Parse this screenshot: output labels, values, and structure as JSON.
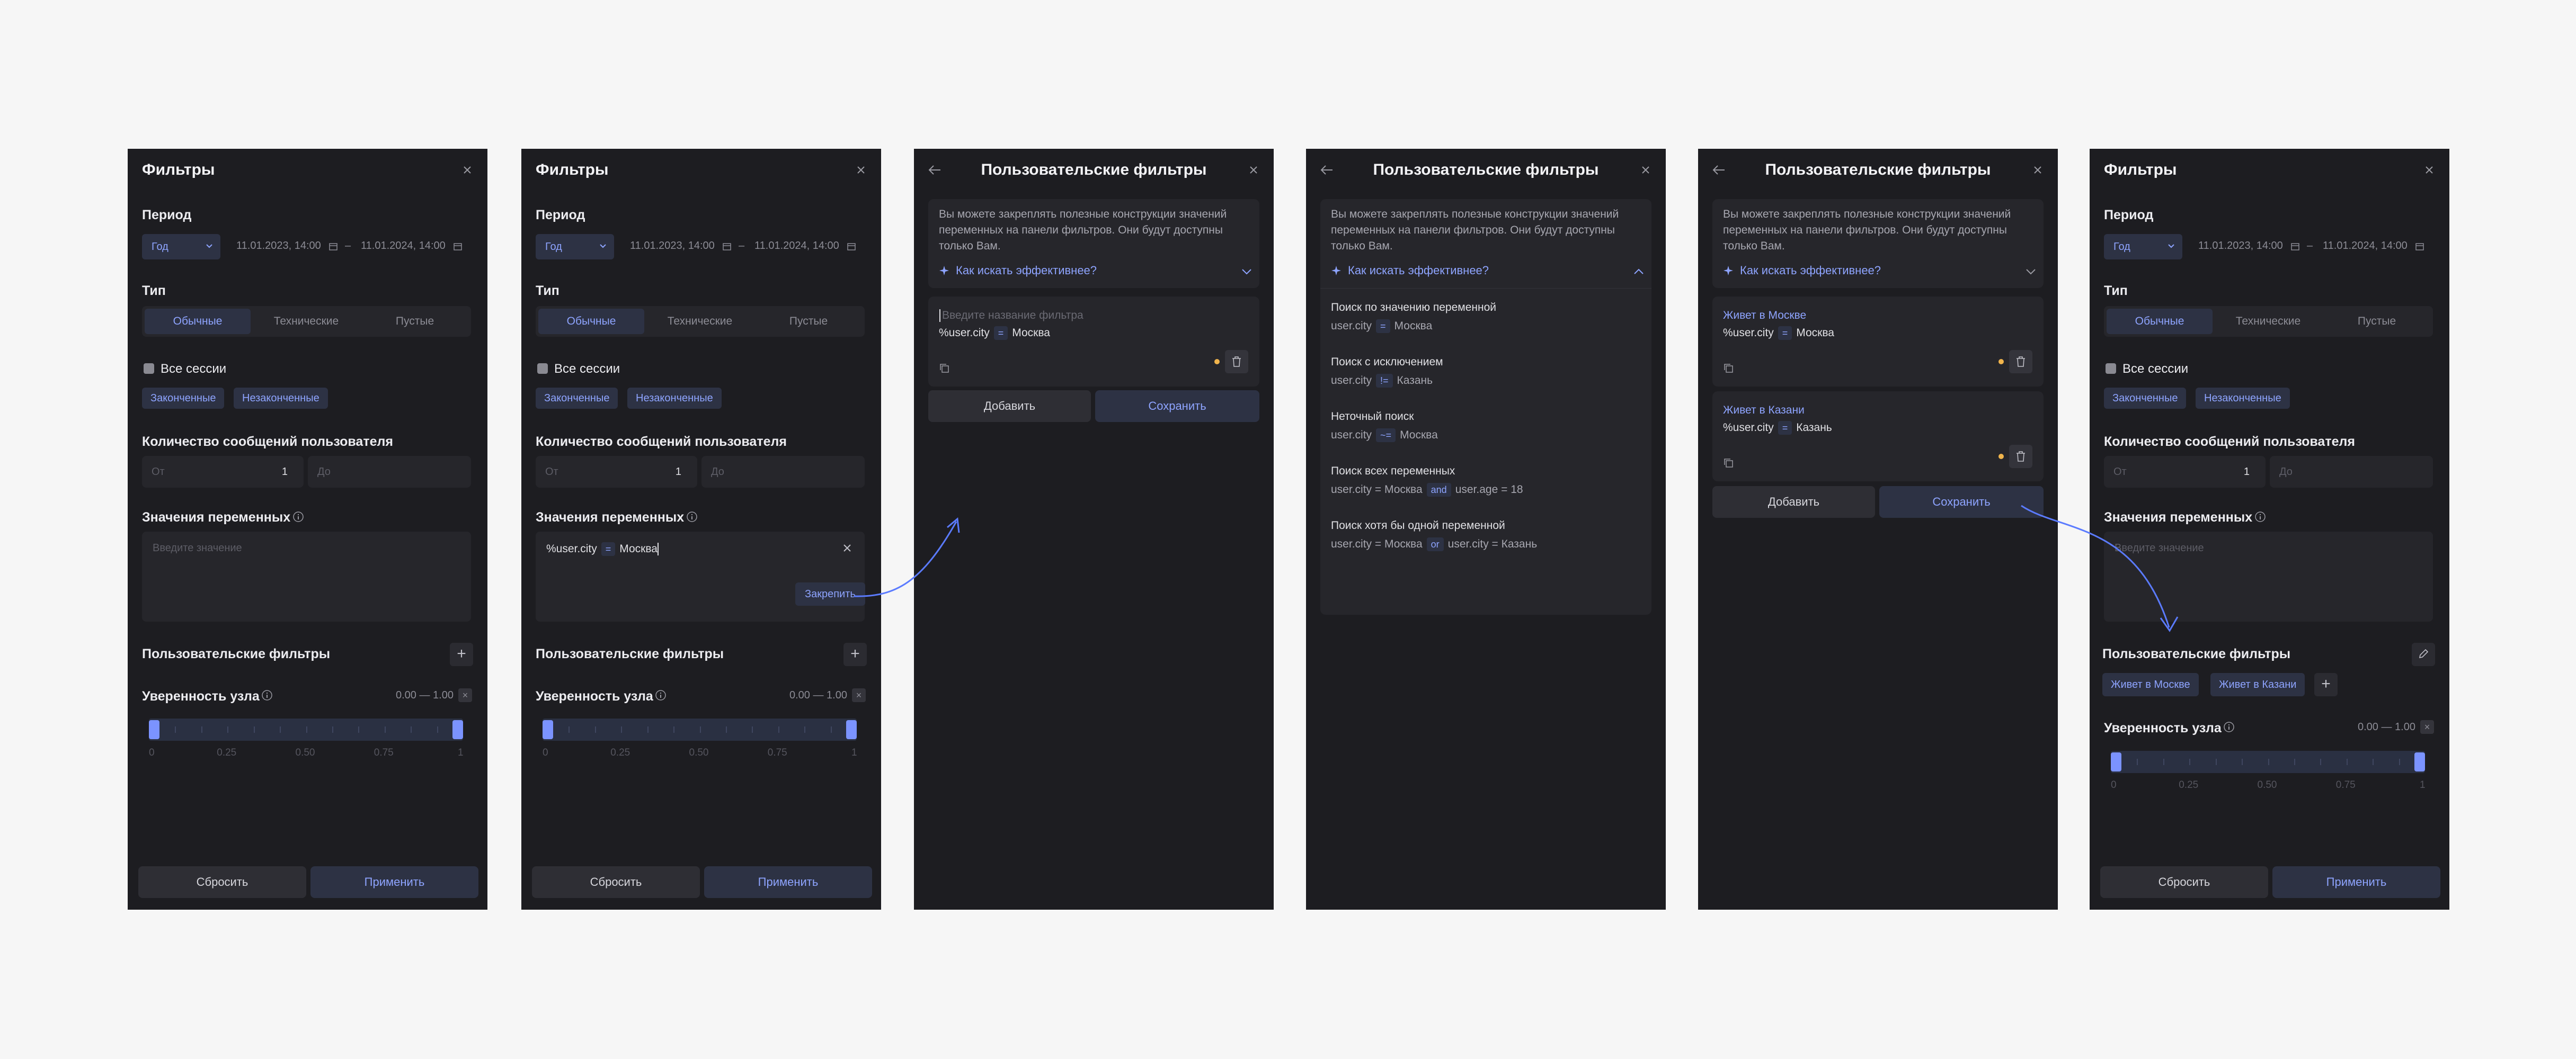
{
  "filters": {
    "title": "Фильтры",
    "period_label": "Период",
    "period_select": "Год",
    "date_from": "11.01.2023, 14:00",
    "date_sep": "–",
    "date_to": "11.01.2024, 14:00",
    "type_label": "Тип",
    "type_options": [
      "Обычные",
      "Технические",
      "Пустые"
    ],
    "all_sessions": "Все сессии",
    "session_chips": [
      "Законченные",
      "Незаконченные"
    ],
    "msg_count_label": "Количество сообщений пользователя",
    "from_placeholder": "От",
    "from_value": "1",
    "to_placeholder": "До",
    "vars_label": "Значения переменных",
    "vars_placeholder": "Введите значение",
    "vars_entered": {
      "var": "%user.city",
      "op": "=",
      "value": "Москва"
    },
    "pin_button": "Закрепить",
    "custom_label": "Пользовательские фильтры",
    "custom_chips": [
      "Живет в Москве",
      "Живет в Казани"
    ],
    "confidence_label": "Уверенность узла",
    "confidence_range": "0.00 — 1.00",
    "slider": {
      "min": 0,
      "max": 1,
      "low": 0,
      "high": 1
    },
    "ticks": [
      "0",
      "0.25",
      "0.50",
      "0.75",
      "1"
    ],
    "reset": "Сбросить",
    "apply": "Применить"
  },
  "custom": {
    "title": "Пользовательские фильтры",
    "info_text": "Вы можете закреплять полезные конструкции значений переменных на панели фильтров. Они будут доступны только Вам.",
    "how_link": "Как искать эффективнее?",
    "name_placeholder": "Введите название фильтра",
    "expr": {
      "var": "%user.city",
      "op": "=",
      "value": "Москва"
    },
    "add": "Добавить",
    "save": "Сохранить",
    "tips": [
      {
        "title": "Поиск по значению переменной",
        "left": "user.city",
        "op": "=",
        "right": "Москва"
      },
      {
        "title": "Поиск с исключением",
        "left": "user.city",
        "op": "!=",
        "right": "Казань"
      },
      {
        "title": "Неточный поиск",
        "left": "user.city",
        "op": "~=",
        "right": "Москва"
      },
      {
        "title": "Поиск всех переменных",
        "left": "user.city = Москва",
        "op": "and",
        "right": "user.age = 18"
      },
      {
        "title": "Поиск хотя бы одной переменной",
        "left": "user.city = Москва",
        "op": "or",
        "right": "user.city = Казань"
      }
    ],
    "saved": [
      {
        "name": "Живет в Москве",
        "var": "%user.city",
        "op": "=",
        "value": "Москва"
      },
      {
        "name": "Живет в Казани",
        "var": "%user.city",
        "op": "=",
        "value": "Казань"
      }
    ]
  },
  "colors": {
    "panel": "#1d1d21",
    "accent": "#8ea4ff",
    "arrow": "#5b7bff",
    "dot": "#f0b44c"
  }
}
